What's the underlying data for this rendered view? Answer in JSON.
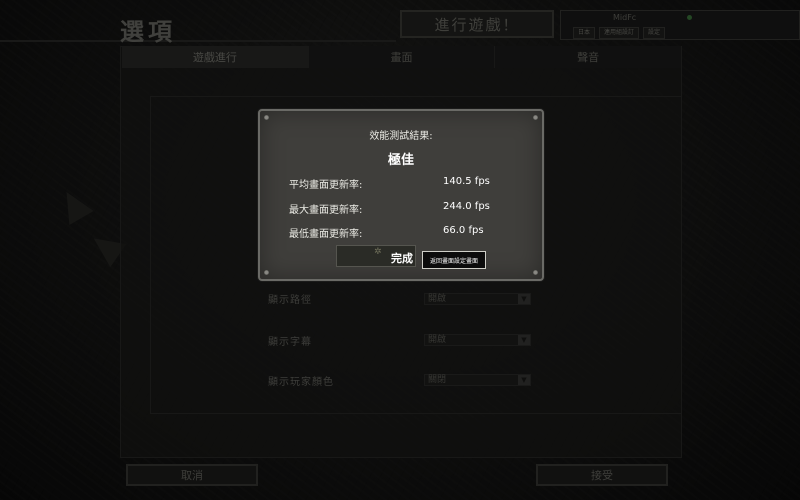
{
  "header": {
    "title": "選項",
    "play_button": "進行遊戲！",
    "user": {
      "name": "MidFc",
      "tabs": [
        "日本",
        "連用組設訂",
        "設定"
      ]
    }
  },
  "tabs": [
    "遊戲進行",
    "畫面",
    "聲音"
  ],
  "options": [
    {
      "label": "顯示路徑",
      "value": "開啟"
    },
    {
      "label": "顯示字幕",
      "value": "開啟"
    },
    {
      "label": "顯示玩家顏色",
      "value": "關閉"
    }
  ],
  "footer": {
    "cancel_label": "取消",
    "accept_label": "接受"
  },
  "dialog": {
    "title": "效能測試結果:",
    "rating": "極佳",
    "stats": [
      {
        "label": "平均畫面更新率:",
        "value": "140.5 fps"
      },
      {
        "label": "最大畫面更新率:",
        "value": "244.0 fps"
      },
      {
        "label": "最低畫面更新率:",
        "value": "66.0 fps"
      }
    ],
    "done_label": "完成",
    "tooltip": "返回畫面設定畫面"
  },
  "colors": {
    "background": "#141414",
    "dialog_bg": "#3f3e3b",
    "dialog_border": "#6a6a66",
    "text_bright": "#ffffff",
    "text_dim": "#6b6b65"
  }
}
